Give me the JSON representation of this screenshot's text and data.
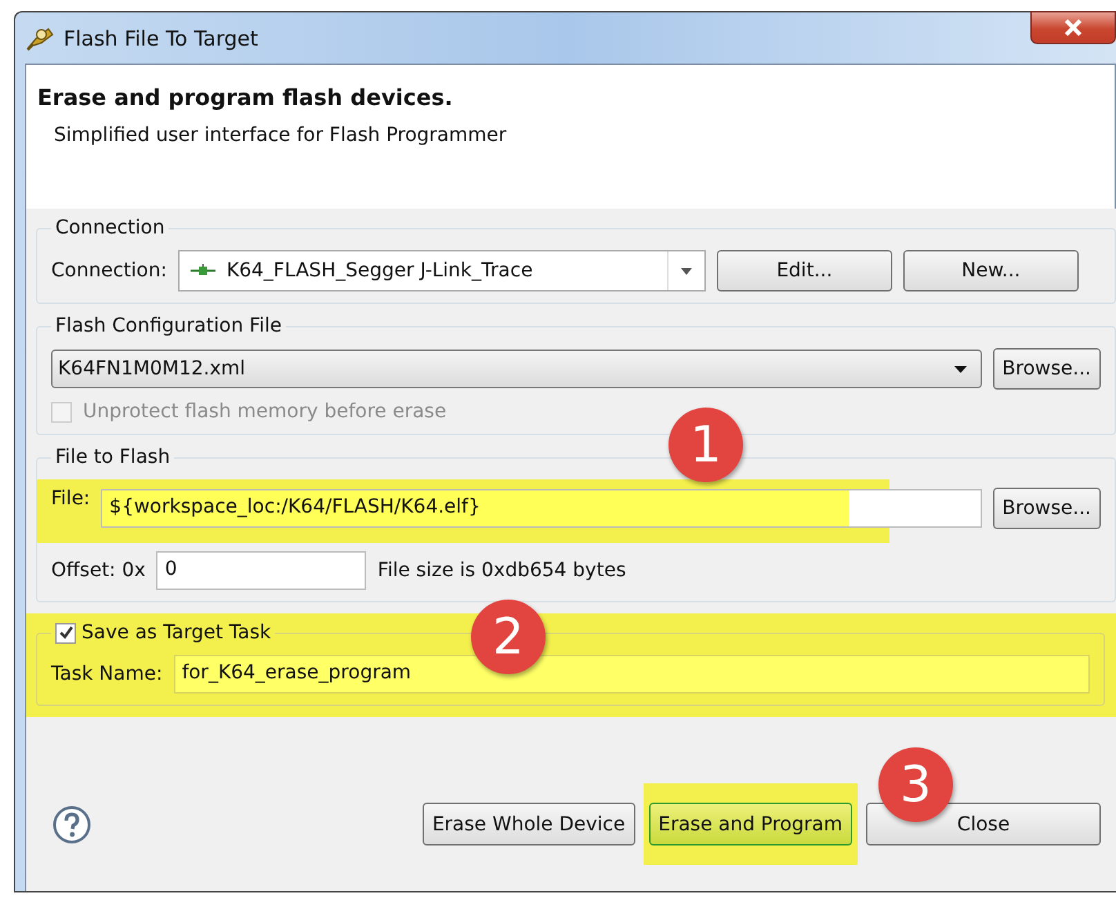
{
  "window": {
    "title": "Flash File To Target"
  },
  "header": {
    "title": "Erase and program flash devices.",
    "subtitle": "Simplified user interface for Flash Programmer"
  },
  "connection_group": {
    "legend": "Connection",
    "label": "Connection:",
    "value": "K64_FLASH_Segger J-Link_Trace",
    "buttons": [
      "Edit...",
      "New..."
    ]
  },
  "flash_config_group": {
    "legend": "Flash Configuration File",
    "value": "K64FN1M0M12.xml",
    "browse": "Browse...",
    "unprotect": {
      "label": "Unprotect flash memory before erase",
      "checked": false,
      "disabled": true
    }
  },
  "file_group": {
    "legend": "File to Flash",
    "file_label": "File:",
    "file_value": "${workspace_loc:/K64/FLASH/K64.elf}",
    "highlighted": true,
    "browse": "Browse...",
    "offset_label": "Offset: 0x",
    "offset_value": "0",
    "size_text": "File size is 0xdb654 bytes"
  },
  "task_group": {
    "legend": "Save as Target Task",
    "checked": true,
    "highlighted": true,
    "name_label": "Task Name:",
    "name_value": "for_K64_erase_program"
  },
  "buttons": [
    {
      "label": "Erase Whole Device",
      "highlighted": false
    },
    {
      "label": "Erase and Program",
      "highlighted": true
    },
    {
      "label": "Close",
      "highlighted": false
    }
  ],
  "annotations": [
    {
      "number": "1"
    },
    {
      "number": "2"
    },
    {
      "number": "3"
    }
  ]
}
